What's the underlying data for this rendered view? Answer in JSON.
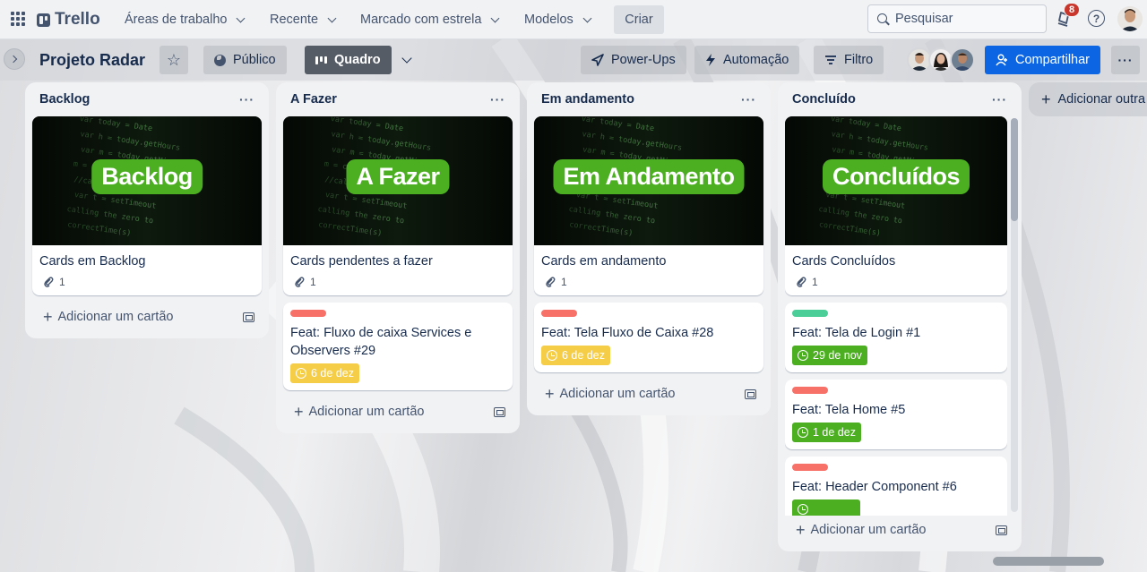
{
  "topnav": {
    "logo": "Trello",
    "menus": [
      "Áreas de trabalho",
      "Recente",
      "Marcado com estrela",
      "Modelos"
    ],
    "create": "Criar",
    "search_placeholder": "Pesquisar",
    "notifications": "8",
    "help": "?"
  },
  "board": {
    "title": "Projeto Radar",
    "visibility": "Público",
    "view": "Quadro",
    "powerups": "Power-Ups",
    "automation": "Automação",
    "filter": "Filtro",
    "share": "Compartilhar",
    "add_list": "Adicionar outra lista"
  },
  "colors": {
    "accent": "#0c66e4",
    "cover_pill": "#4caf22",
    "label_red": "#f87168",
    "label_green": "#4bce97",
    "due_yellow": "#f5cd47",
    "due_green": "#4caf22"
  },
  "lists": [
    {
      "title": "Backlog",
      "cards": [
        {
          "cover": "Backlog",
          "title": "Cards em Backlog",
          "attachments": "1"
        }
      ],
      "add": "Adicionar um cartão"
    },
    {
      "title": "A Fazer",
      "cards": [
        {
          "cover": "A Fazer",
          "title": "Cards pendentes a fazer",
          "attachments": "1"
        },
        {
          "label": "red",
          "title": "Feat: Fluxo de caixa Services e Observers #29",
          "due": "6 de dez",
          "due_color": "yellow"
        }
      ],
      "add": "Adicionar um cartão"
    },
    {
      "title": "Em andamento",
      "cards": [
        {
          "cover": "Em Andamento",
          "title": "Cards em andamento",
          "attachments": "1"
        },
        {
          "label": "red",
          "title": "Feat: Tela Fluxo de Caixa #28",
          "due": "6 de dez",
          "due_color": "yellow"
        }
      ],
      "add": "Adicionar um cartão"
    },
    {
      "title": "Concluído",
      "cards": [
        {
          "cover": "Concluídos",
          "title": "Cards Concluídos",
          "attachments": "1"
        },
        {
          "label": "green",
          "title": "Feat: Tela de Login #1",
          "due": "29 de nov",
          "due_color": "green"
        },
        {
          "label": "red",
          "title": "Feat: Tela Home #5",
          "due": "1 de dez",
          "due_color": "green"
        },
        {
          "label": "red",
          "title": "Feat: Header Component #6",
          "due": "",
          "due_color": "green"
        }
      ],
      "add": "Adicionar um cartão"
    }
  ]
}
